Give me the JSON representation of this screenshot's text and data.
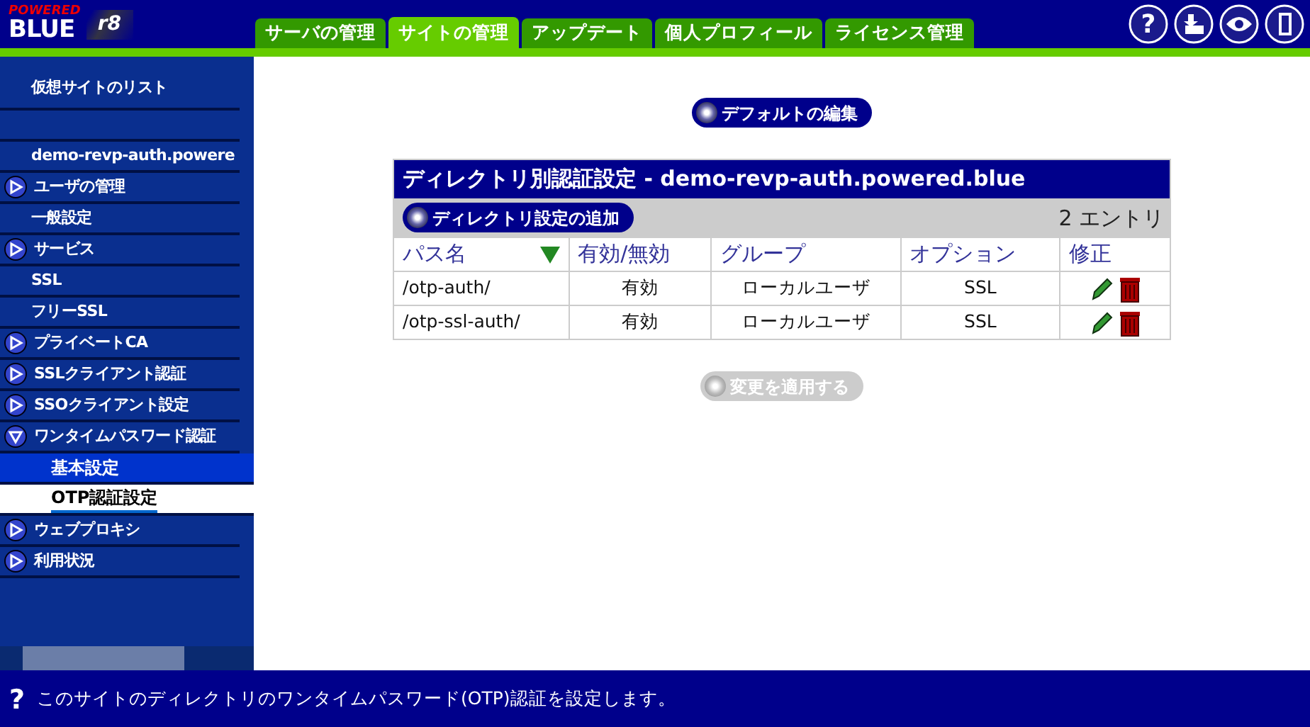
{
  "logo": {
    "top": "POWERED",
    "main": "BLUE",
    "version": "r8"
  },
  "tabs": [
    {
      "label": "サーバの管理",
      "selected": false
    },
    {
      "label": "サイトの管理",
      "selected": true
    },
    {
      "label": "アップデート",
      "selected": false
    },
    {
      "label": "個人プロフィール",
      "selected": false
    },
    {
      "label": "ライセンス管理",
      "selected": false
    }
  ],
  "sidebar": {
    "items": [
      {
        "kind": "heading",
        "label": "仮想サイトのリスト"
      },
      {
        "kind": "blank"
      },
      {
        "kind": "item",
        "label": "demo-revp-auth.powere"
      },
      {
        "kind": "group",
        "label": "ユーザの管理",
        "expanded": false
      },
      {
        "kind": "item",
        "label": "一般設定"
      },
      {
        "kind": "group",
        "label": "サービス",
        "expanded": false
      },
      {
        "kind": "item",
        "label": "SSL"
      },
      {
        "kind": "item",
        "label": "フリーSSL"
      },
      {
        "kind": "group",
        "label": "プライベートCA",
        "expanded": false
      },
      {
        "kind": "group",
        "label": "SSLクライアント認証",
        "expanded": false
      },
      {
        "kind": "group",
        "label": "SSOクライアント設定",
        "expanded": false
      },
      {
        "kind": "group",
        "label": "ワンタイムパスワード認証",
        "expanded": true,
        "children": [
          {
            "label": "基本設定",
            "selected": false
          },
          {
            "label": "OTP認証設定",
            "selected": true
          }
        ]
      },
      {
        "kind": "group",
        "label": "ウェブプロキシ",
        "expanded": false
      },
      {
        "kind": "group",
        "label": "利用状況",
        "expanded": false
      }
    ]
  },
  "default_button": "デフォルトの編集",
  "table": {
    "title": "ディレクトリ別認証設定 - demo-revp-auth.powered.blue",
    "add_button": "ディレクトリ設定の追加",
    "count": "2 エントリ",
    "columns": [
      {
        "label": "パス名",
        "sorted": true
      },
      {
        "label": "有効/無効",
        "sorted": false
      },
      {
        "label": "グループ",
        "sorted": false
      },
      {
        "label": "オプション",
        "sorted": false
      },
      {
        "label": "修正",
        "sorted": false
      }
    ],
    "rows": [
      [
        "/otp-auth/",
        "有効",
        "ローカルユーザ",
        "SSL"
      ],
      [
        "/otp-ssl-auth/",
        "有効",
        "ローカルユーザ",
        "SSL"
      ]
    ]
  },
  "apply_button": {
    "label": "変更を適用する",
    "disabled": true
  },
  "header_help_glyph": "?",
  "status_glyph": "?",
  "status_bar": "このサイトのディレクトリのワンタイムパスワード(OTP)認証を設定します。"
}
